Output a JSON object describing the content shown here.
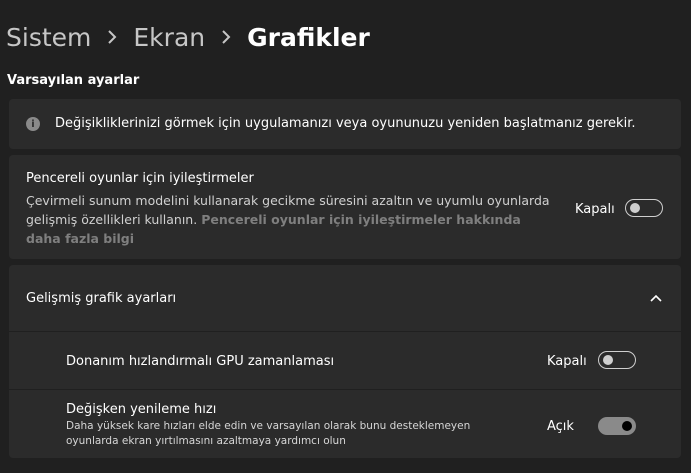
{
  "breadcrumb": {
    "items": [
      "Sistem",
      "Ekran",
      "Grafikler"
    ]
  },
  "section_title": "Varsayılan ayarlar",
  "info_banner": {
    "icon": "info-icon",
    "text": "Değişikliklerinizi görmek için uygulamanızı veya oyununuzu yeniden başlatmanız gerekir."
  },
  "windowed_games": {
    "title": "Pencereli oyunlar için iyileştirmeler",
    "description": "Çevirmeli sunum modelini kullanarak gecikme süresini azaltın ve uyumlu oyunlarda gelişmiş özellikleri kullanın.",
    "link": "Pencereli oyunlar için iyileştirmeler hakkında daha fazla bilgi",
    "state_label": "Kapalı",
    "enabled": false
  },
  "advanced": {
    "title": "Gelişmiş grafik ayarları",
    "expanded": true,
    "gpu_scheduling": {
      "title": "Donanım hızlandırmalı GPU zamanlaması",
      "state_label": "Kapalı",
      "enabled": false
    },
    "variable_refresh": {
      "title": "Değişken yenileme hızı",
      "description": "Daha yüksek kare hızları elde edin ve varsayılan olarak bunu desteklemeyen oyunlarda ekran yırtılmasını azaltmaya yardımcı olun",
      "state_label": "Açık",
      "enabled": true
    }
  },
  "colors": {
    "background": "#202020",
    "card": "#2b2b2b",
    "toggle_on": "#8a8a8a"
  }
}
